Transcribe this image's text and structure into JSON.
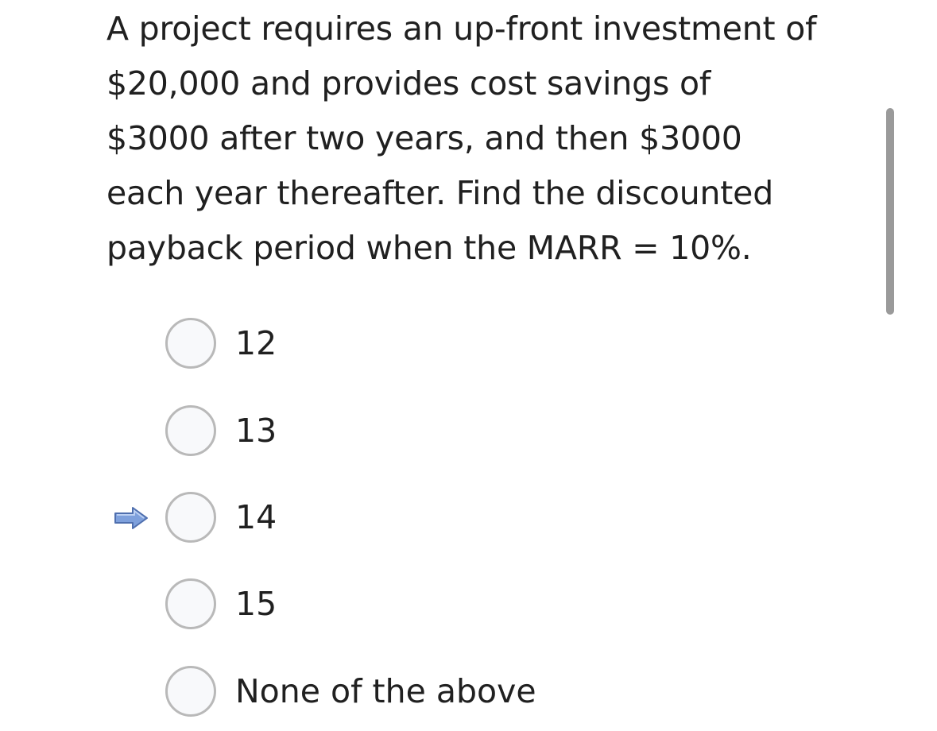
{
  "question": {
    "lines": [
      "A project requires an up-front investment of",
      "$20,000 and provides cost savings of",
      "$3000 after two years, and then $3000",
      "each year thereafter. Find the discounted",
      "payback period when the MARR = 10%."
    ]
  },
  "options": [
    {
      "label": "12"
    },
    {
      "label": "13"
    },
    {
      "label": "14"
    },
    {
      "label": "15"
    },
    {
      "label": "None of the above"
    }
  ],
  "pointer": {
    "icon": "right-arrow-icon",
    "target_option": "14",
    "color": "#6b8fd0"
  }
}
